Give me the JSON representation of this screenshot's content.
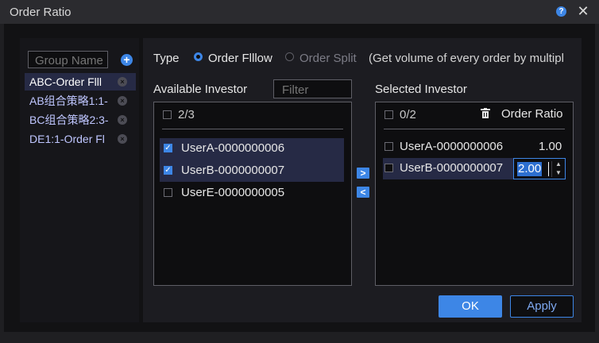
{
  "window": {
    "title": "Order Ratio",
    "help_icon": "question-icon",
    "close_icon": "close-icon"
  },
  "colors": {
    "accent": "#3d86e6",
    "background": "#121214",
    "selected_row": "#262a45"
  },
  "groups": {
    "search_placeholder": "Group Name",
    "add_icon": "plus-icon",
    "items": [
      {
        "label": "ABC-Order Flll",
        "selected": true
      },
      {
        "label": "AB组合策略1:1-",
        "selected": false
      },
      {
        "label": "BC组合策略2:3-",
        "selected": false
      },
      {
        "label": "DE1:1-Order Fl",
        "selected": false
      }
    ]
  },
  "type": {
    "label": "Type",
    "options": [
      {
        "label": "Order Flllow",
        "selected": true
      },
      {
        "label": "Order Split",
        "selected": false
      }
    ],
    "hint": "(Get volume of every order by multipl"
  },
  "available": {
    "title": "Available Investor",
    "filter_placeholder": "Filter",
    "count": "2/3",
    "items": [
      {
        "label": "UserA-0000000006",
        "checked": true
      },
      {
        "label": "UserB-0000000007",
        "checked": true
      },
      {
        "label": "UserE-0000000005",
        "checked": false
      }
    ]
  },
  "transfer": {
    "add": ">",
    "remove": "<"
  },
  "selected": {
    "title": "Selected Investor",
    "count": "0/2",
    "delete_icon": "trash-icon",
    "ratio_header": "Order Ratio",
    "items": [
      {
        "label": "UserA-0000000006",
        "ratio": "1.00"
      },
      {
        "label": "UserB-0000000007",
        "ratio": "2.00"
      }
    ]
  },
  "buttons": {
    "ok": "OK",
    "apply": "Apply"
  }
}
